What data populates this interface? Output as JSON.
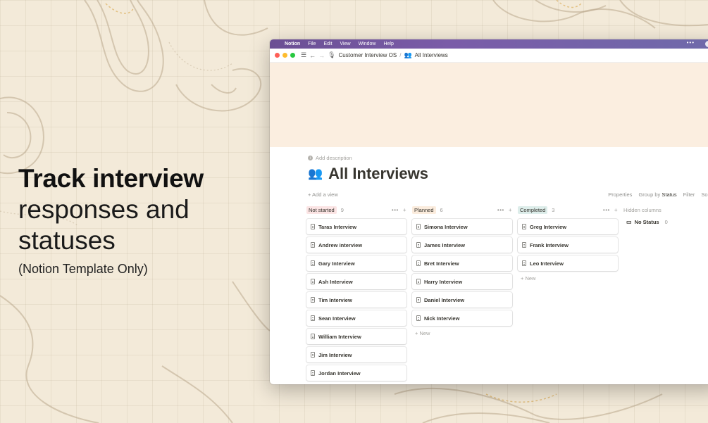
{
  "hero": {
    "title": "Track interview",
    "subtitle_line1": "responses and",
    "subtitle_line2": "statuses",
    "note": "(Notion Template Only)"
  },
  "menubar": {
    "app_name": "Notion",
    "items": [
      "File",
      "Edit",
      "View",
      "Window",
      "Help"
    ],
    "more": "•••"
  },
  "titlebar": {
    "breadcrumb_parent": "Customer Interview OS",
    "breadcrumb_separator": "/",
    "breadcrumb_current": "All Interviews"
  },
  "page": {
    "add_description": "Add description",
    "title": "All Interviews",
    "add_view": "+ Add a view",
    "toolbar": {
      "properties": "Properties",
      "group_by_label": "Group by",
      "group_by_value": "Status",
      "filter": "Filter",
      "sort": "Sor"
    }
  },
  "board": {
    "columns": [
      {
        "name": "Not started",
        "count": "9",
        "color": "#fbe4e4",
        "cards": [
          "Taras Interview",
          "Andrew interview",
          "Gary Interview",
          "Ash Interview",
          "Tim Interview",
          "Sean Interview",
          "William Interview",
          "Jim Interview",
          "Jordan Interview"
        ]
      },
      {
        "name": "Planned",
        "count": "6",
        "color": "#fbecdd",
        "cards": [
          "Simona Interview",
          "James Interview",
          "Bret Interview",
          "Harry Interview",
          "Daniel Interview",
          "Nick Interview"
        ],
        "new_label": "+ New"
      },
      {
        "name": "Completed",
        "count": "3",
        "color": "#ddedea",
        "cards": [
          "Greg Interview",
          "Frank Interview",
          "Leo Interview"
        ],
        "new_label": "+ New"
      }
    ],
    "hidden_columns_label": "Hidden columns",
    "no_status_label": "No Status",
    "no_status_count": "0",
    "column_actions": "•••",
    "column_add": "+"
  }
}
